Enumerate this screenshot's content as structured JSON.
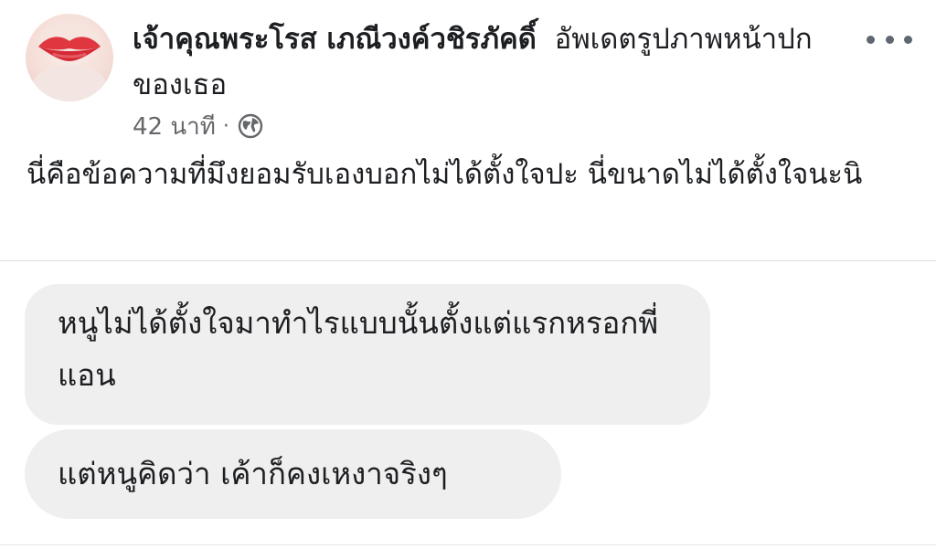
{
  "post": {
    "author_name": "เจ้าคุณพระโรส เภณีวงค์วชิรภัคดิ์",
    "action": "อัพเดตรูปภาพหน้าปกของเธอ",
    "timestamp": "42 นาที",
    "separator": "·",
    "privacy_icon": "globe-icon",
    "more_icon": "more-options-icon",
    "body": "นี่คือข้อความที่มึงยอมรับเองบอกไม่ได้ตั้งใจปะ นี่ขนาดไม่ได้ตั้งใจนะนิ",
    "avatar_icon": "profile-photo-lips"
  },
  "messages": [
    {
      "text": "หนูไม่ได้ตั้งใจมาทำไรแบบนั้นตั้งแต่แรกหรอกพี่แอน"
    },
    {
      "text": "แต่หนูคิดว่า เค้าก็คงเหงาจริงๆ"
    }
  ],
  "colors": {
    "text_primary": "#1c1e21",
    "text_secondary": "#65676b",
    "bubble_bg": "#efefef",
    "divider": "#dadde1"
  }
}
